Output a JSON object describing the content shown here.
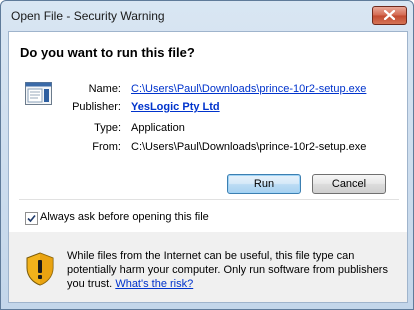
{
  "window": {
    "title": "Open File - Security Warning"
  },
  "dialog": {
    "heading": "Do you want to run this file?",
    "fields": {
      "name_label": "Name:",
      "name_value": "C:\\Users\\Paul\\Downloads\\prince-10r2-setup.exe",
      "publisher_label": "Publisher:",
      "publisher_value": "YesLogic Pty Ltd",
      "type_label": "Type:",
      "type_value": "Application",
      "from_label": "From:",
      "from_value": "C:\\Users\\Paul\\Downloads\\prince-10r2-setup.exe"
    },
    "buttons": {
      "run_label": "Run",
      "cancel_label": "Cancel"
    },
    "checkbox": {
      "label": "Always ask before opening this file",
      "checked": true
    }
  },
  "warning": {
    "text": "While files from the Internet can be useful, this file type can potentially harm your computer. Only run software from publishers you trust.",
    "link": "What's the risk?"
  },
  "colors": {
    "link": "#0033cc",
    "close_button": "#c24a30",
    "frame": "#c3d6ea"
  }
}
